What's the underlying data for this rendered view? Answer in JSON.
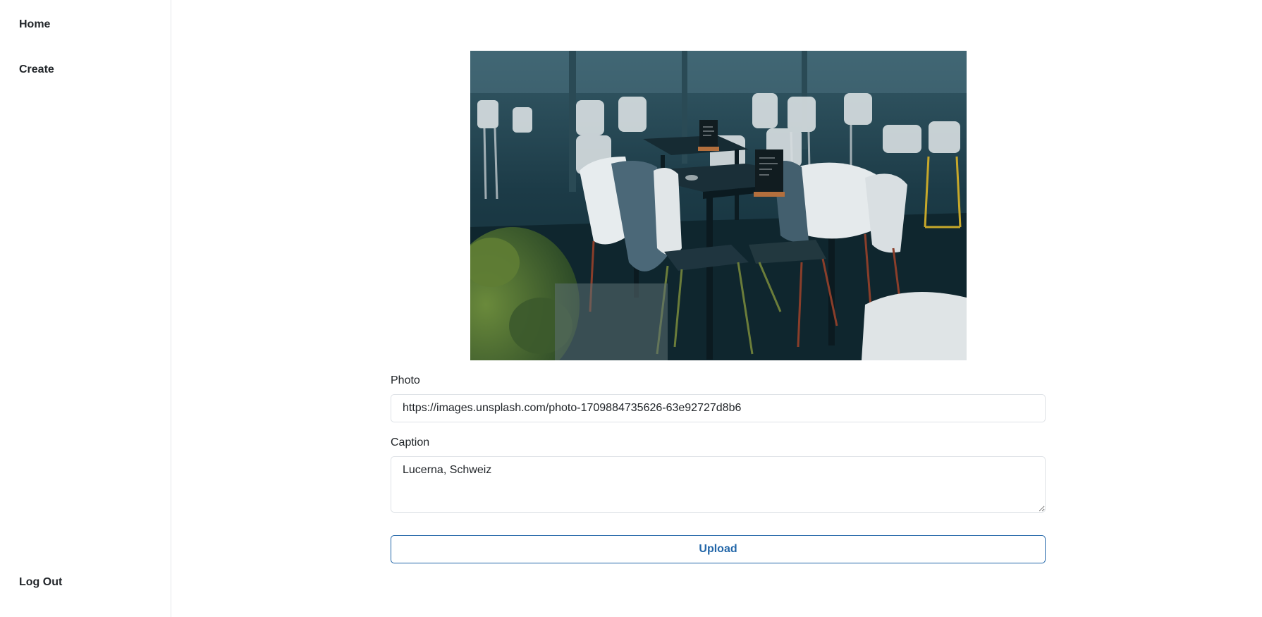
{
  "sidebar": {
    "home_label": "Home",
    "create_label": "Create",
    "logout_label": "Log Out"
  },
  "form": {
    "photo_label": "Photo",
    "photo_value": "https://images.unsplash.com/photo-1709884735626-63e92727d8b6",
    "caption_label": "Caption",
    "caption_value": "Lucerna, Schweiz",
    "upload_label": "Upload"
  },
  "colors": {
    "accent": "#2266a8",
    "text": "#212529",
    "border": "#dee2e6"
  }
}
